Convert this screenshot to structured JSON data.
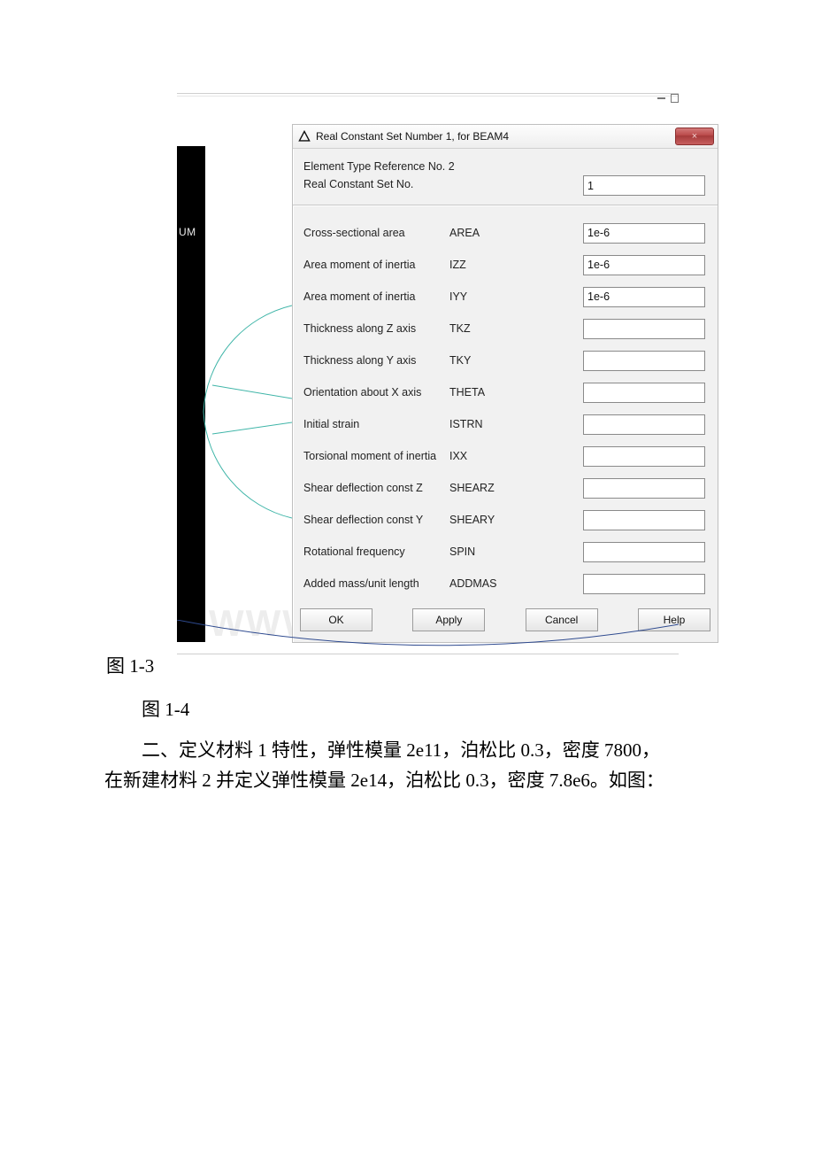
{
  "snapshot": {
    "left_label": "UM",
    "dialog": {
      "title": "Real Constant Set Number 1, for BEAM4",
      "close_glyph": "×",
      "ref_label": "Element Type Reference No. 2",
      "setno_label": "Real Constant Set No.",
      "setno_value": "1",
      "rows": [
        {
          "desc": "Cross-sectional area",
          "code": "AREA",
          "value": "1e-6"
        },
        {
          "desc": "Area moment of inertia",
          "code": "IZZ",
          "value": "1e-6"
        },
        {
          "desc": "Area moment of inertia",
          "code": "IYY",
          "value": "1e-6"
        },
        {
          "desc": "Thickness along Z axis",
          "code": "TKZ",
          "value": ""
        },
        {
          "desc": "Thickness along Y axis",
          "code": "TKY",
          "value": ""
        },
        {
          "desc": "Orientation about X axis",
          "code": "THETA",
          "value": ""
        },
        {
          "desc": "Initial strain",
          "code": "ISTRN",
          "value": ""
        },
        {
          "desc": "Torsional moment of inertia",
          "code": "IXX",
          "value": ""
        },
        {
          "desc": "Shear deflection const Z",
          "code": "SHEARZ",
          "value": ""
        },
        {
          "desc": "Shear deflection const Y",
          "code": "SHEARY",
          "value": ""
        },
        {
          "desc": "Rotational frequency",
          "code": "SPIN",
          "value": ""
        },
        {
          "desc": "Added mass/unit length",
          "code": "ADDMAS",
          "value": ""
        }
      ],
      "buttons": {
        "ok": "OK",
        "apply": "Apply",
        "cancel": "Cancel",
        "help": "Help"
      }
    },
    "watermark": "WWW.            .com"
  },
  "captions": {
    "fig_1_3": "图 1-3",
    "fig_1_4": "图 1-4"
  },
  "paragraph": {
    "line1": "二、定义材料 1 特性，弹性模量 2e11，泊松比 0.3，密度 7800，",
    "line2": "在新建材料 2 并定义弹性模量 2e14，泊松比 0.3，密度 7.8e6。如图："
  }
}
